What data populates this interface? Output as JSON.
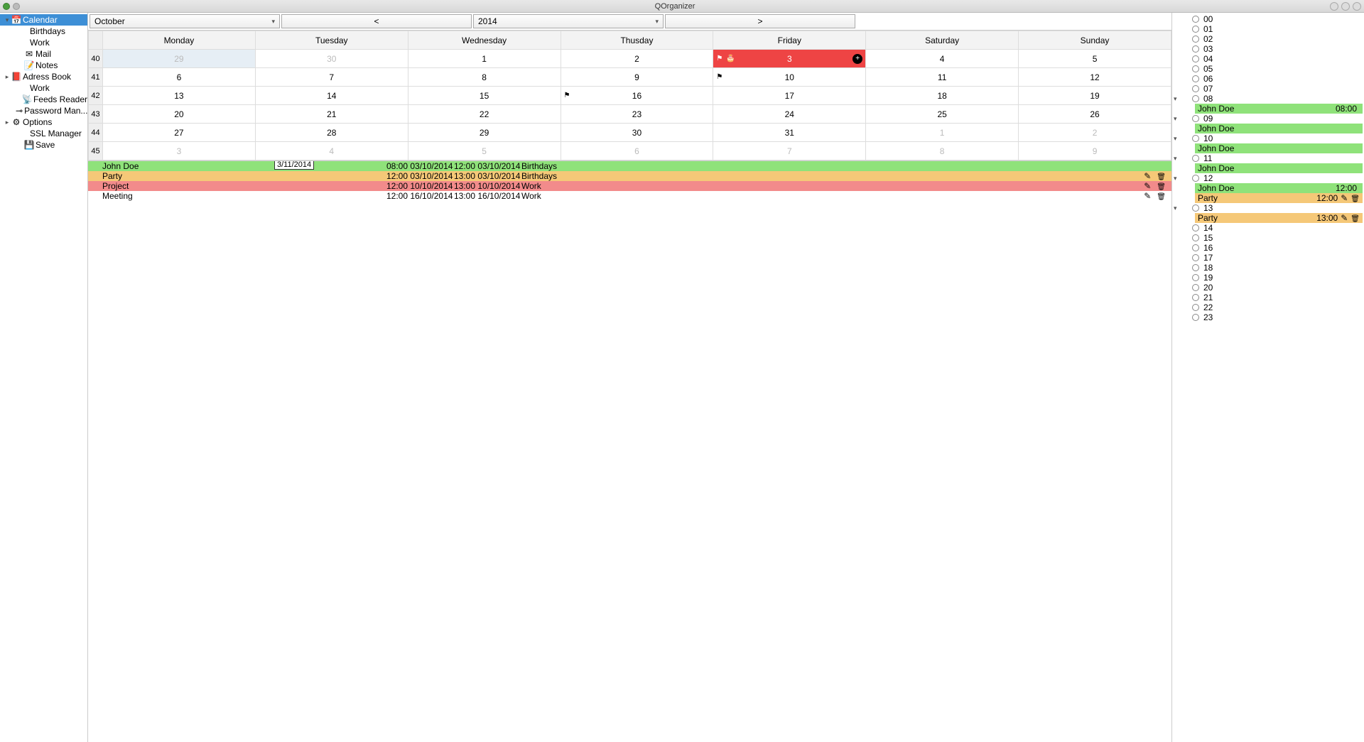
{
  "title": "QOrganizer",
  "sidebar": {
    "items": [
      {
        "label": "Calendar",
        "expandable": true,
        "expanded": true,
        "selected": true,
        "icon": "cal"
      },
      {
        "label": "Birthdays",
        "level": 2
      },
      {
        "label": "Work",
        "level": 2
      },
      {
        "label": "Mail",
        "icon": "mail"
      },
      {
        "label": "Notes",
        "icon": "note"
      },
      {
        "label": "Adress Book",
        "expandable": true,
        "icon": "book"
      },
      {
        "label": "Work",
        "level": 2
      },
      {
        "label": "Feeds Reader",
        "icon": "feed"
      },
      {
        "label": "Password Man...",
        "icon": "key"
      },
      {
        "label": "Options",
        "expandable": true,
        "icon": "gear"
      },
      {
        "label": "SSL Manager",
        "level": 2
      },
      {
        "label": "Save",
        "icon": "save"
      }
    ]
  },
  "toolbar": {
    "month": "October",
    "year": "2014",
    "prev": "<",
    "next": ">"
  },
  "calendar": {
    "days": [
      "Monday",
      "Tuesday",
      "Wednesday",
      "Thusday",
      "Friday",
      "Saturday",
      "Sunday"
    ],
    "weeks": [
      {
        "wk": "40",
        "cells": [
          {
            "n": "29",
            "other": true,
            "sel": true
          },
          {
            "n": "30",
            "other": true
          },
          {
            "n": "1"
          },
          {
            "n": "2"
          },
          {
            "n": "3",
            "today": true,
            "flag": true,
            "cake": true,
            "add": true
          },
          {
            "n": "4"
          },
          {
            "n": "5"
          }
        ]
      },
      {
        "wk": "41",
        "cells": [
          {
            "n": "6"
          },
          {
            "n": "7"
          },
          {
            "n": "8"
          },
          {
            "n": "9"
          },
          {
            "n": "10",
            "flag": true
          },
          {
            "n": "11"
          },
          {
            "n": "12"
          }
        ]
      },
      {
        "wk": "42",
        "cells": [
          {
            "n": "13"
          },
          {
            "n": "14"
          },
          {
            "n": "15"
          },
          {
            "n": "16",
            "flag": true
          },
          {
            "n": "17"
          },
          {
            "n": "18"
          },
          {
            "n": "19"
          }
        ]
      },
      {
        "wk": "43",
        "cells": [
          {
            "n": "20"
          },
          {
            "n": "21"
          },
          {
            "n": "22"
          },
          {
            "n": "23"
          },
          {
            "n": "24"
          },
          {
            "n": "25"
          },
          {
            "n": "26"
          }
        ]
      },
      {
        "wk": "44",
        "cells": [
          {
            "n": "27"
          },
          {
            "n": "28"
          },
          {
            "n": "29"
          },
          {
            "n": "30"
          },
          {
            "n": "31"
          },
          {
            "n": "1",
            "other": true
          },
          {
            "n": "2",
            "other": true
          }
        ]
      },
      {
        "wk": "45",
        "cells": [
          {
            "n": "3",
            "other": true
          },
          {
            "n": "4",
            "other": true
          },
          {
            "n": "5",
            "other": true
          },
          {
            "n": "6",
            "other": true
          },
          {
            "n": "7",
            "other": true
          },
          {
            "n": "8",
            "other": true
          },
          {
            "n": "9",
            "other": true
          }
        ]
      }
    ]
  },
  "events": {
    "badge": "3/11/2014",
    "rows": [
      {
        "name": "John Doe",
        "start": "08:00 03/10/2014",
        "end": "12:00 03/10/2014",
        "cat": "Birthdays",
        "cls": "green",
        "badge": true
      },
      {
        "name": "Party",
        "start": "12:00 03/10/2014",
        "end": "13:00 03/10/2014",
        "cat": "Birthdays",
        "cls": "orange",
        "actions": true
      },
      {
        "name": "Project",
        "start": "12:00 10/10/2014",
        "end": "13:00 10/10/2014",
        "cat": "Work",
        "cls": "red",
        "actions": true
      },
      {
        "name": "Meeting",
        "start": "12:00 16/10/2014",
        "end": "13:00 16/10/2014",
        "cat": "Work",
        "cls": "",
        "actions": true
      }
    ]
  },
  "daypanel": {
    "hours": [
      {
        "h": "00"
      },
      {
        "h": "01"
      },
      {
        "h": "02"
      },
      {
        "h": "03"
      },
      {
        "h": "04"
      },
      {
        "h": "05"
      },
      {
        "h": "06"
      },
      {
        "h": "07"
      },
      {
        "h": "08",
        "exp": true,
        "evts": [
          {
            "name": "John Doe",
            "time": "08:00",
            "cls": "green"
          }
        ]
      },
      {
        "h": "09",
        "exp": true,
        "evts": [
          {
            "name": "John Doe",
            "time": "",
            "cls": "green"
          }
        ]
      },
      {
        "h": "10",
        "exp": true,
        "evts": [
          {
            "name": "John Doe",
            "time": "",
            "cls": "green"
          }
        ]
      },
      {
        "h": "11",
        "exp": true,
        "evts": [
          {
            "name": "John Doe",
            "time": "",
            "cls": "green"
          }
        ]
      },
      {
        "h": "12",
        "exp": true,
        "evts": [
          {
            "name": "John Doe",
            "time": "12:00",
            "cls": "green"
          },
          {
            "name": "Party",
            "time": "12:00",
            "cls": "orange",
            "actions": true
          }
        ]
      },
      {
        "h": "13",
        "exp": true,
        "evts": [
          {
            "name": "Party",
            "time": "13:00",
            "cls": "orange",
            "actions": true
          }
        ]
      },
      {
        "h": "14"
      },
      {
        "h": "15"
      },
      {
        "h": "16"
      },
      {
        "h": "17"
      },
      {
        "h": "18"
      },
      {
        "h": "19"
      },
      {
        "h": "20"
      },
      {
        "h": "21"
      },
      {
        "h": "22"
      },
      {
        "h": "23"
      }
    ]
  },
  "icons": {
    "cal": "📅",
    "mail": "✉",
    "note": "📝",
    "book": "📕",
    "feed": "📡",
    "key": "⊸",
    "gear": "⚙",
    "save": "💾"
  }
}
